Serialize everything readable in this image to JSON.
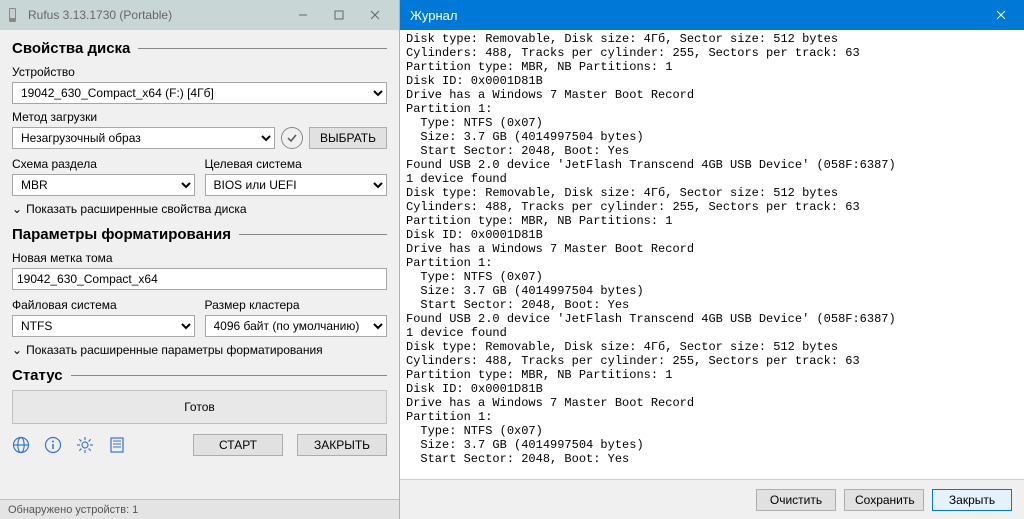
{
  "left": {
    "title": "Rufus 3.13.1730 (Portable)",
    "sections": {
      "drive_props": "Свойства диска",
      "format_opts": "Параметры форматирования",
      "status": "Статус"
    },
    "device": {
      "label": "Устройство",
      "value": "19042_630_Compact_x64 (F:) [4Гб]"
    },
    "boot": {
      "label": "Метод загрузки",
      "value": "Незагрузочный образ",
      "select_btn": "ВЫБРАТЬ"
    },
    "scheme": {
      "label": "Схема раздела",
      "value": "MBR"
    },
    "target": {
      "label": "Целевая система",
      "value": "BIOS или UEFI"
    },
    "adv_drive": "Показать расширенные свойства диска",
    "volume": {
      "label": "Новая метка тома",
      "value": "19042_630_Compact_x64"
    },
    "fs": {
      "label": "Файловая система",
      "value": "NTFS"
    },
    "cluster": {
      "label": "Размер кластера",
      "value": "4096 байт (по умолчанию)"
    },
    "adv_format": "Показать расширенные параметры форматирования",
    "status_text": "Готов",
    "start_btn": "СТАРТ",
    "close_btn": "ЗАКРЫТЬ",
    "footer": "Обнаружено устройств: 1"
  },
  "right": {
    "title": "Журнал",
    "clear_btn": "Очистить",
    "save_btn": "Сохранить",
    "close_btn": "Закрыть",
    "log": "Disk type: Removable, Disk size: 4Гб, Sector size: 512 bytes\nCylinders: 488, Tracks per cylinder: 255, Sectors per track: 63\nPartition type: MBR, NB Partitions: 1\nDisk ID: 0x0001D81B\nDrive has a Windows 7 Master Boot Record\nPartition 1:\n  Type: NTFS (0x07)\n  Size: 3.7 GB (4014997504 bytes)\n  Start Sector: 2048, Boot: Yes\nFound USB 2.0 device 'JetFlash Transcend 4GB USB Device' (058F:6387)\n1 device found\nDisk type: Removable, Disk size: 4Гб, Sector size: 512 bytes\nCylinders: 488, Tracks per cylinder: 255, Sectors per track: 63\nPartition type: MBR, NB Partitions: 1\nDisk ID: 0x0001D81B\nDrive has a Windows 7 Master Boot Record\nPartition 1:\n  Type: NTFS (0x07)\n  Size: 3.7 GB (4014997504 bytes)\n  Start Sector: 2048, Boot: Yes\nFound USB 2.0 device 'JetFlash Transcend 4GB USB Device' (058F:6387)\n1 device found\nDisk type: Removable, Disk size: 4Гб, Sector size: 512 bytes\nCylinders: 488, Tracks per cylinder: 255, Sectors per track: 63\nPartition type: MBR, NB Partitions: 1\nDisk ID: 0x0001D81B\nDrive has a Windows 7 Master Boot Record\nPartition 1:\n  Type: NTFS (0x07)\n  Size: 3.7 GB (4014997504 bytes)\n  Start Sector: 2048, Boot: Yes"
  }
}
